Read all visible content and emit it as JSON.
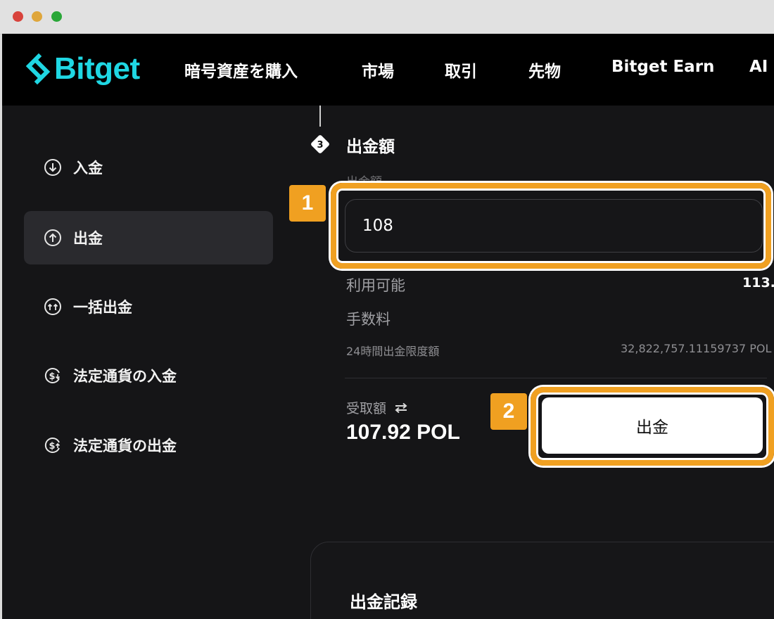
{
  "brand": {
    "name": "Bitget",
    "color": "#1fd7e3"
  },
  "nav": {
    "items": [
      {
        "label": "暗号資産を購入"
      },
      {
        "label": "市場"
      },
      {
        "label": "取引"
      },
      {
        "label": "先物"
      },
      {
        "label": "Bitget Earn"
      },
      {
        "label": "AI"
      }
    ]
  },
  "sidebar": {
    "items": [
      {
        "label": "入金",
        "icon": "arrow-down-circle-icon"
      },
      {
        "label": "出金",
        "icon": "arrow-up-circle-icon",
        "active": true
      },
      {
        "label": "一括出金",
        "icon": "multi-arrow-up-circle-icon"
      },
      {
        "label": "法定通貨の入金",
        "icon": "dollar-in-icon"
      },
      {
        "label": "法定通貨の出金",
        "icon": "dollar-out-icon"
      }
    ]
  },
  "withdraw_form": {
    "step_number": "3",
    "step_title": "出金額",
    "amount_label": "出金額",
    "amount_value": "108",
    "available_label": "利用可能",
    "available_value": "113.",
    "fee_label": "手数料",
    "limit_label": "24時間出金限度額",
    "limit_value": "32,822,757.11159737 POL",
    "receive_label": "受取額",
    "receive_amount": "107.92 POL",
    "submit_label": "出金"
  },
  "annotations": {
    "badge_1": "1",
    "badge_2": "2",
    "highlight_color": "#f0a021"
  },
  "records": {
    "title": "出金記録"
  }
}
